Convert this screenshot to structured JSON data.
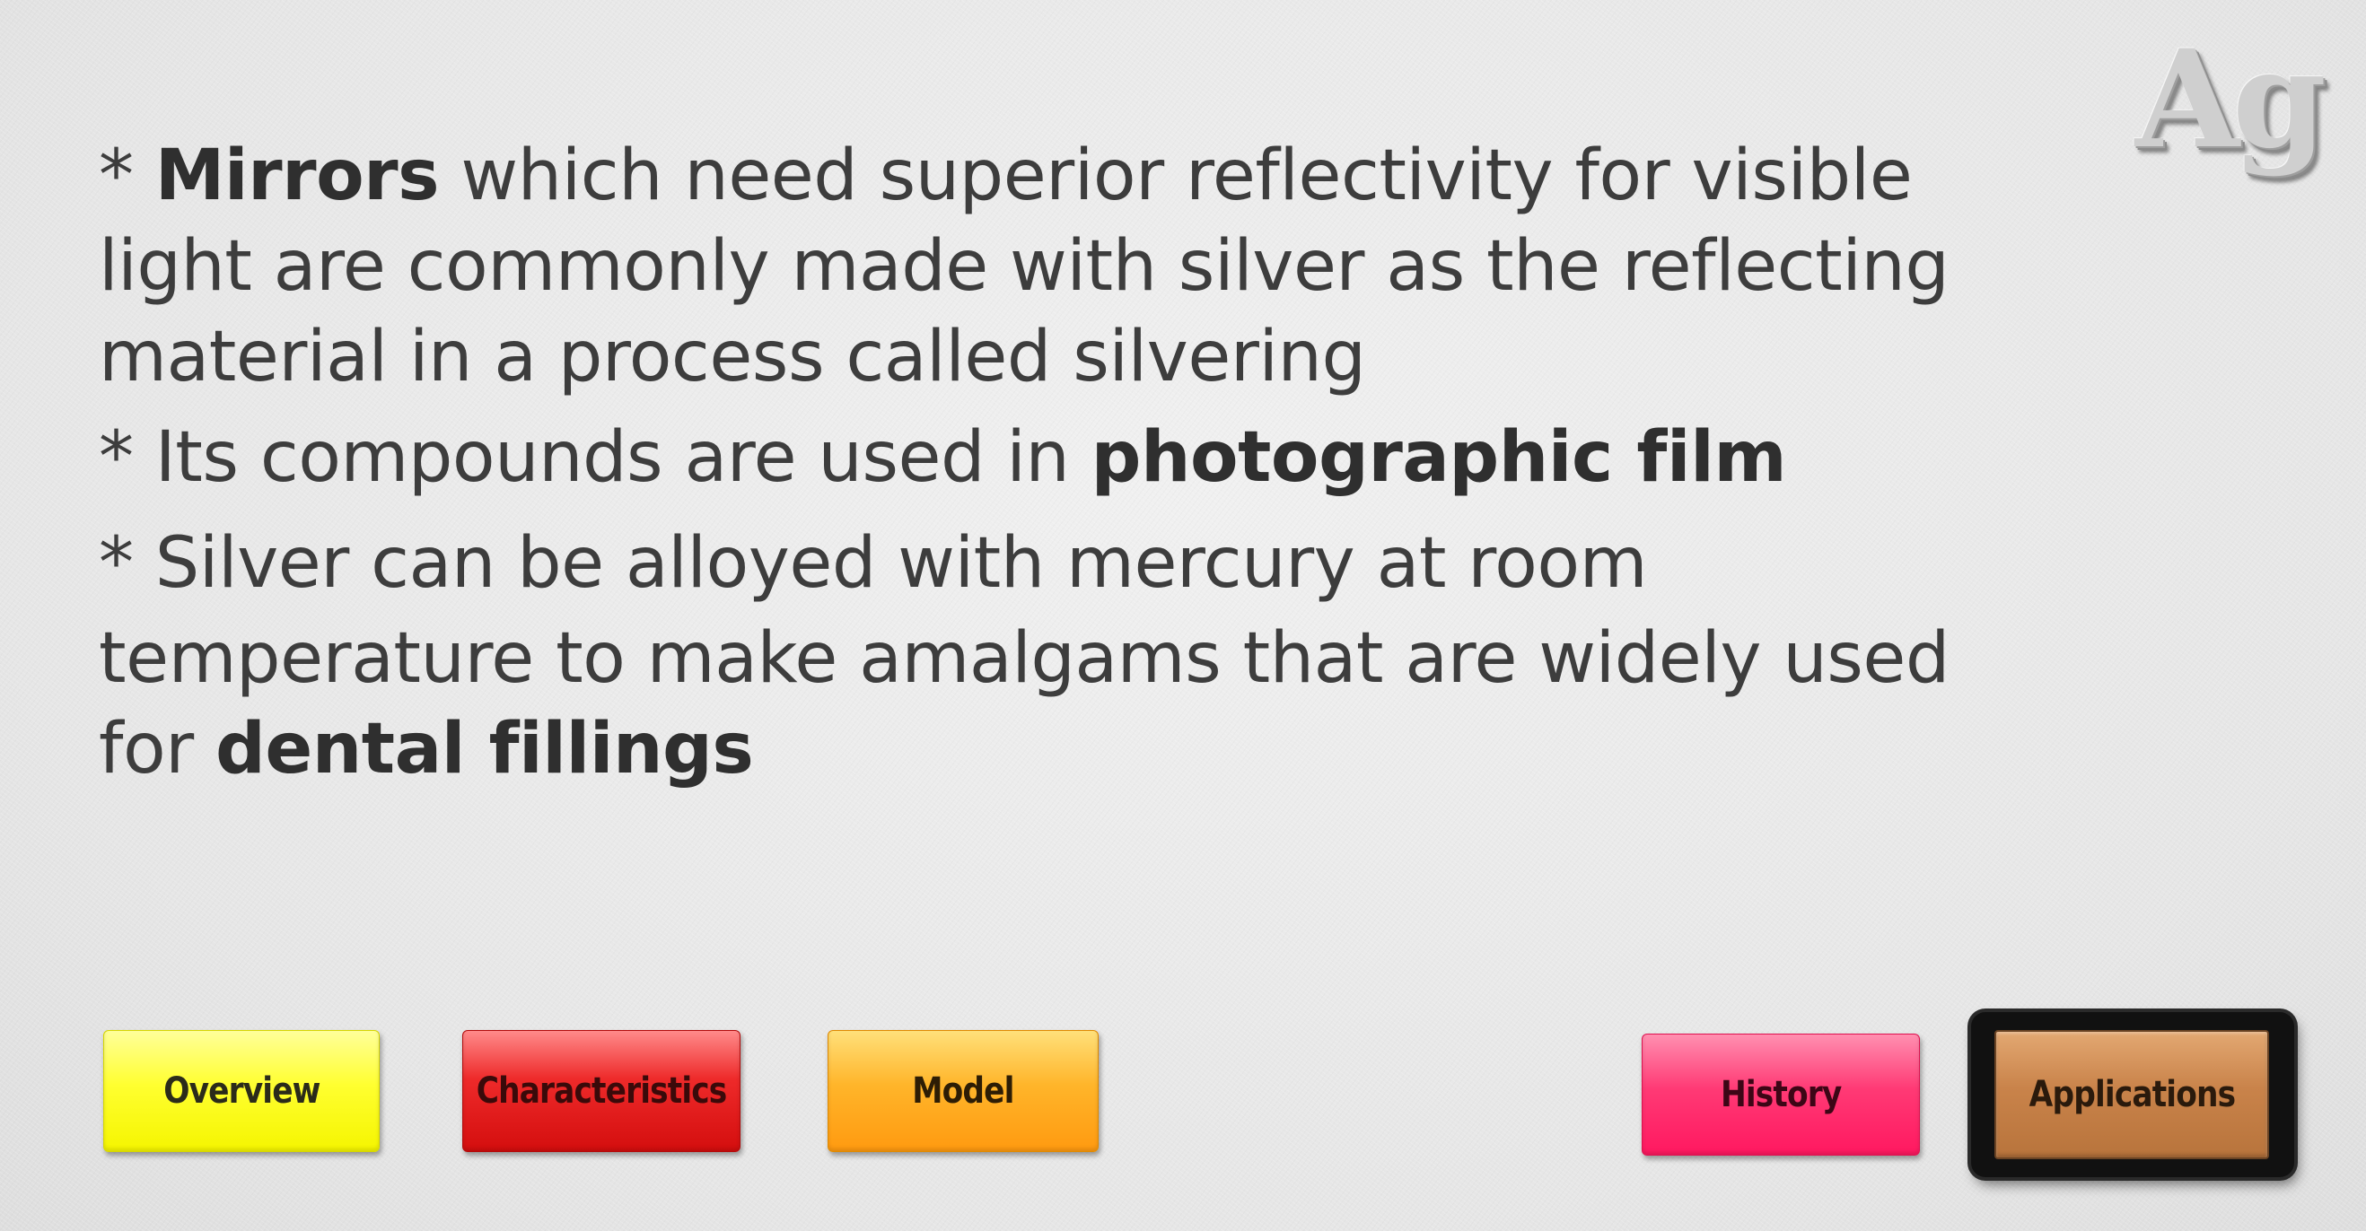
{
  "logo": {
    "text": "Ag"
  },
  "content": {
    "p1": {
      "prefix": "* ",
      "bold": "Mirrors",
      "rest": " which need superior reflectivity for visible light are commonly made with silver as the reflecting material in a process called silvering"
    },
    "p2": {
      "prefix": "* Its compounds are used in ",
      "bold": "photographic film"
    },
    "p3": {
      "line1": "* Silver can be alloyed with mercury at room",
      "line2_prefix": "temperature to make amalgams that are widely used for ",
      "bold": "dental fillings"
    }
  },
  "nav": {
    "overview": "Overview",
    "characteristics": "Characteristics",
    "model": "Model",
    "history": "History",
    "applications": "Applications",
    "active": "applications"
  },
  "colors": {
    "overview": "#ffff30",
    "characteristics": "#ee2a2a",
    "model": "#ffb52a",
    "history": "#ff3a75",
    "applications": "#c9834a",
    "text": "#3d3d3d"
  }
}
